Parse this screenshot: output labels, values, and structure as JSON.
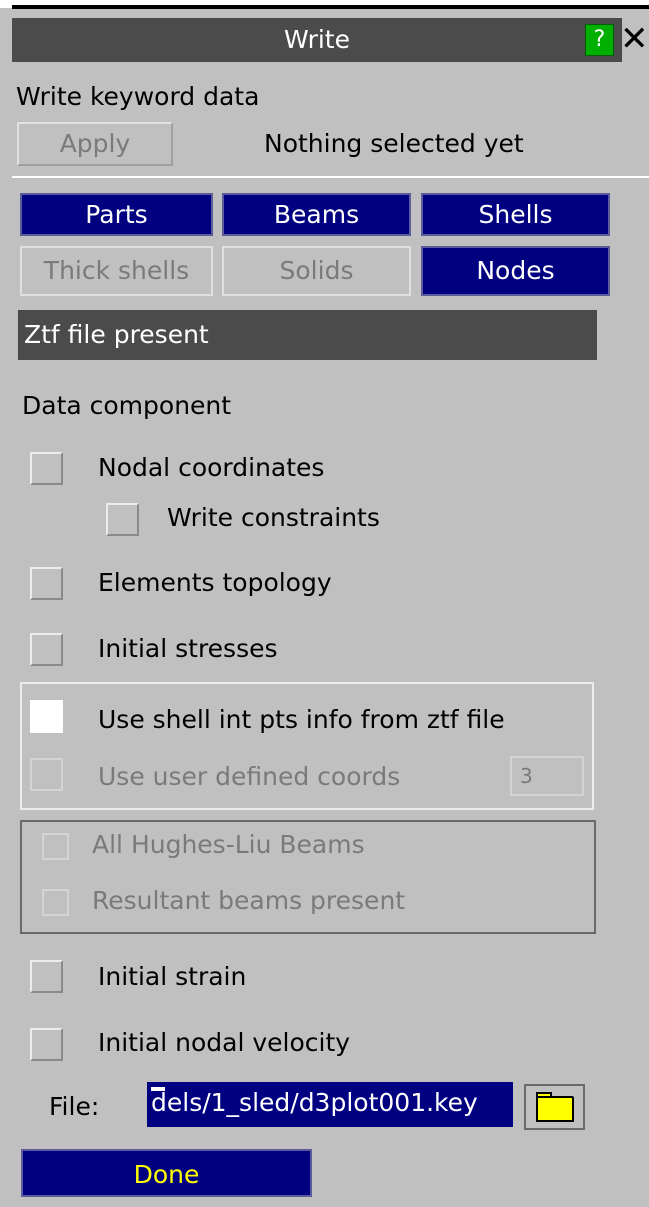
{
  "window": {
    "title": "Write",
    "help_label": "?",
    "close_label": "✕"
  },
  "header": {
    "subtitle": "Write keyword data",
    "apply_label": "Apply",
    "status": "Nothing selected yet"
  },
  "entity_buttons": [
    {
      "label": "Parts",
      "active": true
    },
    {
      "label": "Beams",
      "active": true
    },
    {
      "label": "Shells",
      "active": true
    },
    {
      "label": "Thick shells",
      "active": false
    },
    {
      "label": "Solids",
      "active": false
    },
    {
      "label": "Nodes",
      "active": true
    }
  ],
  "section_title": "Ztf file present",
  "data_component_label": "Data component",
  "options": {
    "nodal_coordinates": "Nodal coordinates",
    "write_constraints": "Write constraints",
    "elements_topology": "Elements topology",
    "initial_stresses": "Initial stresses",
    "use_shell_int_pts": "Use shell int pts info from ztf file",
    "use_user_defined_coords": "Use user defined coords",
    "user_coords_value": "3",
    "all_hughes_liu": "All Hughes-Liu Beams",
    "resultant_beams": "Resultant beams present",
    "initial_strain": "Initial strain",
    "initial_nodal_velocity": "Initial nodal velocity"
  },
  "file": {
    "label": "File:",
    "value": "dels/1_sled/d3plot001.key"
  },
  "done_label": "Done",
  "colors": {
    "title_bar": "#4b4b4b",
    "active_button": "#000080",
    "help_button": "#00b000",
    "done_text": "#ffff00"
  },
  "icons": {
    "help": "help-icon",
    "close": "close-icon",
    "folder": "folder-icon"
  }
}
